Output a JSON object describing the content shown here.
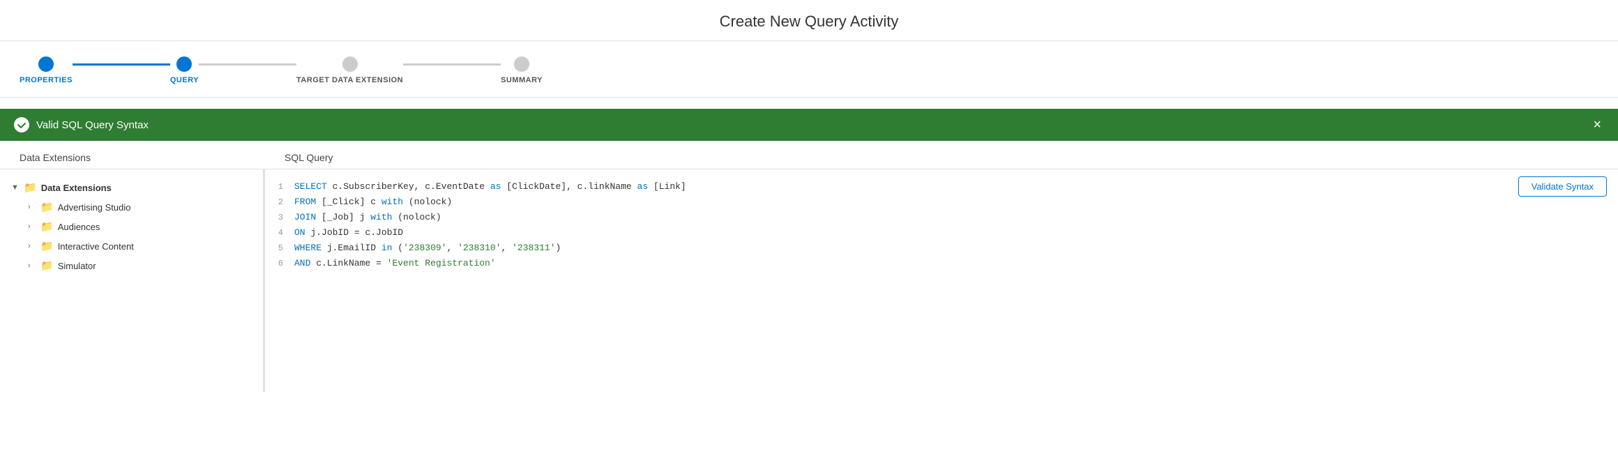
{
  "page": {
    "title": "Create New Query Activity"
  },
  "stepper": {
    "steps": [
      {
        "id": "properties",
        "label": "PROPERTIES",
        "state": "completed"
      },
      {
        "id": "query",
        "label": "QUERY",
        "state": "active"
      },
      {
        "id": "target-data-extension",
        "label": "TARGET DATA EXTENSION",
        "state": "inactive"
      },
      {
        "id": "summary",
        "label": "SUMMARY",
        "state": "inactive"
      }
    ]
  },
  "banner": {
    "message": "Valid SQL Query Syntax",
    "close_label": "×"
  },
  "left_panel": {
    "label": "Data Extensions",
    "tree": [
      {
        "level": 0,
        "expanded": true,
        "label": "Data Extensions"
      },
      {
        "level": 1,
        "expanded": false,
        "label": "Advertising Studio"
      },
      {
        "level": 1,
        "expanded": false,
        "label": "Audiences"
      },
      {
        "level": 1,
        "expanded": false,
        "label": "Interactive Content"
      },
      {
        "level": 1,
        "expanded": false,
        "label": "Simulator"
      }
    ]
  },
  "right_panel": {
    "label": "SQL Query",
    "validate_button": "Validate Syntax",
    "lines": [
      {
        "num": 1,
        "code": "SELECT c.SubscriberKey, c.EventDate as [ClickDate], c.linkName as [Link]"
      },
      {
        "num": 2,
        "code": "FROM [_Click] c with (nolock)"
      },
      {
        "num": 3,
        "code": "JOIN [_Job] j with (nolock)"
      },
      {
        "num": 4,
        "code": "ON j.JobID = c.JobID"
      },
      {
        "num": 5,
        "code": "WHERE j.EmailID in ('238309', '238310', '238311')"
      },
      {
        "num": 6,
        "code": "AND c.LinkName = 'Event Registration'"
      }
    ]
  }
}
